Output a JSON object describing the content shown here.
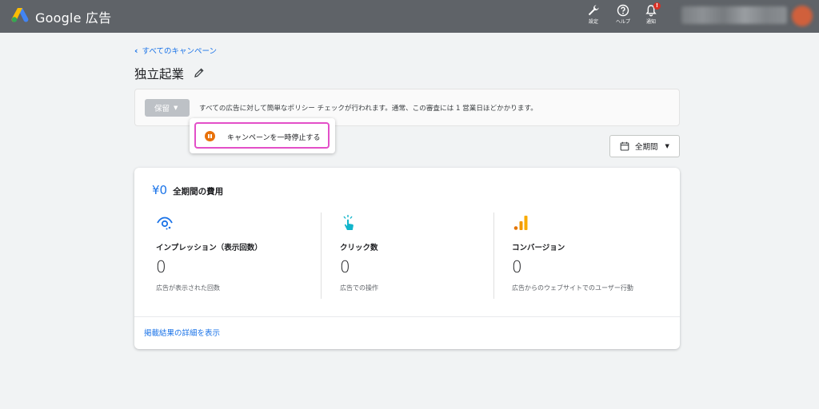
{
  "header": {
    "brand": "Google 広告",
    "settings_label": "設定",
    "help_label": "ヘルプ",
    "notifications_label": "通知",
    "notification_badge": "!"
  },
  "nav": {
    "back_link": "すべてのキャンペーン"
  },
  "campaign": {
    "title": "独立起業"
  },
  "status_banner": {
    "status_label": "保留",
    "message": "すべての広告に対して簡単なポリシー チェックが行われます。通常、この審査には 1 営業日ほどかかります。"
  },
  "status_menu": {
    "pause_label": "キャンペーンを一時停止する"
  },
  "date_range": {
    "label": "全期間"
  },
  "summary": {
    "cost_value": "¥0",
    "cost_label": "全期間の費用",
    "metrics": [
      {
        "icon": "eye-icon",
        "title": "インプレッション（表示回数）",
        "value": "0",
        "description": "広告が表示された回数"
      },
      {
        "icon": "tap-icon",
        "title": "クリック数",
        "value": "0",
        "description": "広告での操作"
      },
      {
        "icon": "bar-chart-icon",
        "title": "コンバージョン",
        "value": "0",
        "description": "広告からのウェブサイトでのユーザー行動"
      }
    ],
    "details_link": "掲載結果の詳細を表示"
  },
  "colors": {
    "topbar": "#5f6368",
    "link": "#1a73e8",
    "pause_icon": "#e8710a",
    "highlight": "#e34fc8",
    "badge": "#d93025"
  }
}
